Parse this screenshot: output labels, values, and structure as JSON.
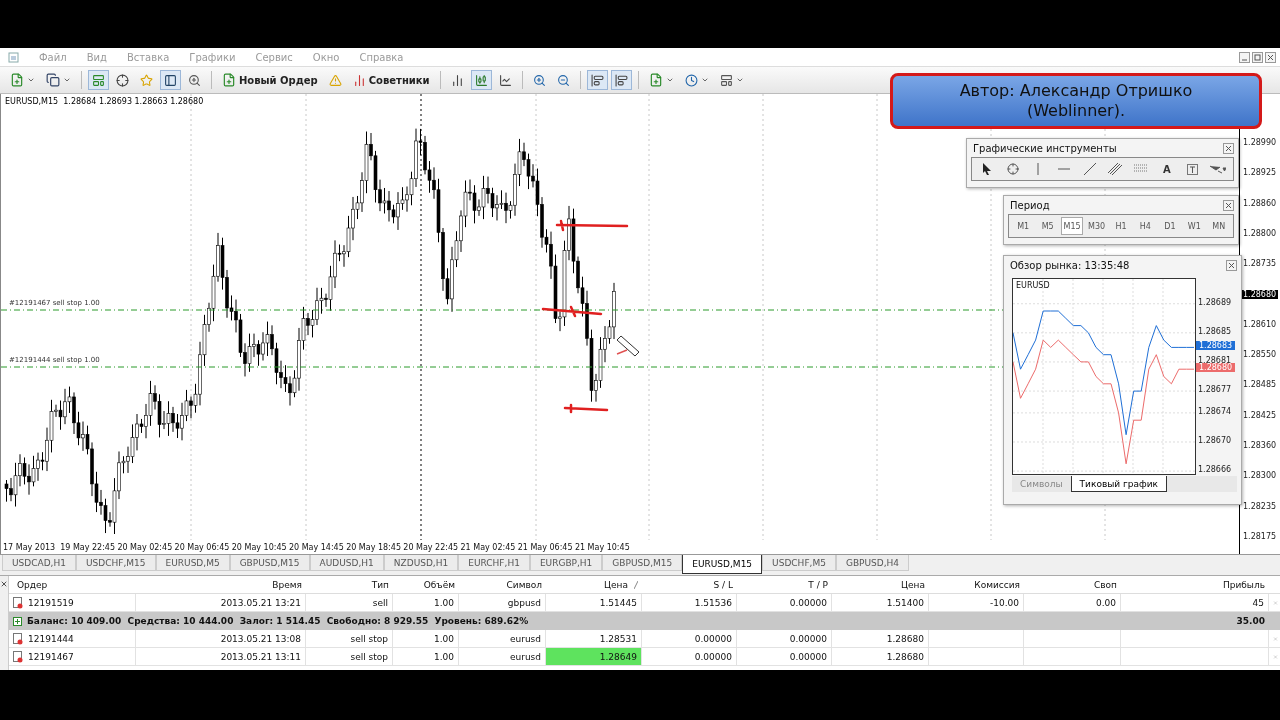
{
  "menu": {
    "items": [
      "Файл",
      "Вид",
      "Вставка",
      "Графики",
      "Сервис",
      "Окно",
      "Справка"
    ]
  },
  "toolbar": {
    "new_order": "Новый Ордер",
    "experts": "Советники"
  },
  "chart": {
    "header": "EURUSD,M15  1.28684 1.28693 1.28663 1.28680",
    "price_labels": [
      {
        "text": "1.28990",
        "current": false
      },
      {
        "text": "1.28925",
        "current": false
      },
      {
        "text": "1.28860",
        "current": false
      },
      {
        "text": "1.28800",
        "current": false
      },
      {
        "text": "1.28735",
        "current": false
      },
      {
        "text": "1.28680",
        "current": true
      },
      {
        "text": "1.28610",
        "current": false
      },
      {
        "text": "1.28550",
        "current": false
      },
      {
        "text": "1.28485",
        "current": false
      },
      {
        "text": "1.28425",
        "current": false
      },
      {
        "text": "1.28360",
        "current": false
      },
      {
        "text": "1.28300",
        "current": false
      },
      {
        "text": "1.28235",
        "current": false
      },
      {
        "text": "1.28175",
        "current": false
      }
    ],
    "time_labels": [
      "17 May 2013",
      "19 May 22:45",
      "20 May 02:45",
      "20 May 06:45",
      "20 May 10:45",
      "20 May 14:45",
      "20 May 18:45",
      "20 May 22:45",
      "21 May 02:45",
      "21 May 06:45",
      "21 May 10:45"
    ],
    "order_lines": [
      {
        "label": "#12191467 sell stop 1.00"
      },
      {
        "label": "#12191444 sell stop 1.00"
      }
    ]
  },
  "banner": {
    "lines": [
      "Автор: Александр Отришко",
      "(Weblinner)."
    ]
  },
  "tools_panel": {
    "title": "Графические инструменты",
    "text_tool": "A"
  },
  "period_panel": {
    "title": "Период",
    "periods": [
      {
        "label": "M1",
        "selected": false
      },
      {
        "label": "M5",
        "selected": false
      },
      {
        "label": "M15",
        "selected": true
      },
      {
        "label": "M30",
        "selected": false
      },
      {
        "label": "H1",
        "selected": false
      },
      {
        "label": "H4",
        "selected": false
      },
      {
        "label": "D1",
        "selected": false
      },
      {
        "label": "W1",
        "selected": false
      },
      {
        "label": "MN",
        "selected": false
      }
    ]
  },
  "market_watch": {
    "title": "Обзор рынка: 13:35:48",
    "symbol": "EURUSD",
    "tags": [
      {
        "text": "1.28683",
        "color": "#1f6fd6"
      },
      {
        "text": "1.28680",
        "color": "#ec6b6b"
      }
    ],
    "chart_data": {
      "type": "line",
      "grid": true,
      "ylim": [
        1.286656,
        1.286924
      ],
      "yticks": [
        {
          "value": 1.28689,
          "label": "1.28689"
        },
        {
          "value": 1.28685,
          "label": "1.28685"
        },
        {
          "value": 1.28681,
          "label": "1.28681"
        },
        {
          "value": 1.28677,
          "label": "1.28677"
        },
        {
          "value": 1.28674,
          "label": "1.28674"
        },
        {
          "value": 1.2867,
          "label": "1.28670"
        },
        {
          "value": 1.28666,
          "label": "1.28666"
        }
      ],
      "series": [
        {
          "color": "#1f6fd6",
          "values": [
            1.28685,
            1.2868,
            1.28682,
            1.28684,
            1.28688,
            1.28688,
            1.28688,
            1.28687,
            1.28686,
            1.28686,
            1.28685,
            1.28683,
            1.28682,
            1.28682,
            1.28678,
            1.28671,
            1.28677,
            1.28677,
            1.28683,
            1.28686,
            1.28684,
            1.28683,
            1.28683,
            1.28683,
            1.28683
          ]
        },
        {
          "color": "#ec6b6b",
          "values": [
            1.28681,
            1.28676,
            1.28678,
            1.2868,
            1.28684,
            1.28683,
            1.28684,
            1.28683,
            1.28682,
            1.28681,
            1.28681,
            1.28679,
            1.28678,
            1.28678,
            1.28674,
            1.28667,
            1.28673,
            1.28673,
            1.2868,
            1.28682,
            1.28679,
            1.28678,
            1.2868,
            1.2868,
            1.2868
          ]
        }
      ]
    },
    "tabs": [
      {
        "label": "Символы",
        "selected": false
      },
      {
        "label": "Тиковый график",
        "selected": true
      }
    ]
  },
  "chart_tabs": [
    {
      "label": "USDCAD,H1",
      "selected": false
    },
    {
      "label": "USDCHF,M15",
      "selected": false
    },
    {
      "label": "EURUSD,M5",
      "selected": false
    },
    {
      "label": "GBPUSD,M15",
      "selected": false
    },
    {
      "label": "AUDUSD,H1",
      "selected": false
    },
    {
      "label": "NZDUSD,H1",
      "selected": false
    },
    {
      "label": "EURCHF,H1",
      "selected": false
    },
    {
      "label": "EURGBP,H1",
      "selected": false
    },
    {
      "label": "GBPUSD,M15",
      "selected": false
    },
    {
      "label": "EURUSD,M15",
      "selected": true
    },
    {
      "label": "USDCHF,M5",
      "selected": false
    },
    {
      "label": "GBPUSD,H4",
      "selected": false
    }
  ],
  "terminal": {
    "columns": [
      "Ордер",
      "Время",
      "Тип",
      "Объём",
      "Символ",
      "Цена",
      "S / L",
      "T / P",
      "Цена",
      "Комиссия",
      "Своп",
      "Прибыль"
    ],
    "rows": [
      {
        "kind": "order",
        "cells": [
          "12191519",
          "2013.05.21 13:21",
          "sell",
          "1.00",
          "gbpusd",
          "1.51445",
          "1.51536",
          "0.00000",
          "1.51400",
          "-10.00",
          "0.00",
          "45"
        ],
        "price_highlight": false
      },
      {
        "kind": "summary",
        "text": "Баланс: 10 409.00  Средства: 10 444.00  Залог: 1 514.45  Свободно: 8 929.55  Уровень: 689.62%",
        "profit": "35.00"
      },
      {
        "kind": "order",
        "cells": [
          "12191444",
          "2013.05.21 13:08",
          "sell stop",
          "1.00",
          "eurusd",
          "1.28531",
          "0.00000",
          "0.00000",
          "1.28680",
          "",
          "",
          ""
        ],
        "price_highlight": false
      },
      {
        "kind": "order",
        "cells": [
          "12191467",
          "2013.05.21 13:11",
          "sell stop",
          "1.00",
          "eurusd",
          "1.28649",
          "0.00000",
          "0.00000",
          "1.28680",
          "",
          "",
          ""
        ],
        "price_highlight": true
      }
    ]
  }
}
